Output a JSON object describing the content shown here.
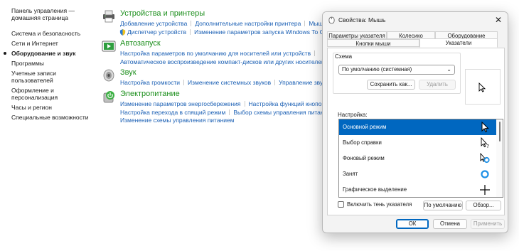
{
  "nav": {
    "home": "Панель управления —\nдомашняя страница",
    "items": [
      {
        "label": "Система и безопасность"
      },
      {
        "label": "Сети и Интернет"
      },
      {
        "label": "Оборудование и звук"
      },
      {
        "label": "Программы"
      },
      {
        "label": "Учетные записи\nпользователей"
      },
      {
        "label": "Оформление и\nперсонализация"
      },
      {
        "label": "Часы и регион"
      },
      {
        "label": "Специальные возможности"
      }
    ]
  },
  "categories": {
    "devices": {
      "title": "Устройства и принтеры",
      "row1": [
        "Добавление устройства",
        "Дополнительные настройки принтера",
        "Мышь"
      ],
      "row2": [
        "Диспетчер устройств",
        "Изменение параметров запуска Windows To Go"
      ]
    },
    "autoplay": {
      "title": "Автозапуск",
      "row1": [
        "Настройка параметров по умолчанию для носителей или устройств"
      ],
      "row2": [
        "Автоматическое воспроизведение компакт-дисков или других носителей"
      ]
    },
    "sound": {
      "title": "Звук",
      "row1": [
        "Настройка громкости",
        "Изменение системных звуков",
        "Управление звук"
      ]
    },
    "power": {
      "title": "Электропитание",
      "row1": [
        "Изменение параметров энергосбережения",
        "Настройка функций кнопок пит"
      ],
      "row2": [
        "Настройка перехода в спящий режим",
        "Выбор схемы управления питанием"
      ],
      "row3": [
        "Изменение схемы управления питанием"
      ]
    }
  },
  "dialog": {
    "title": "Свойства: Мышь",
    "close": "✕",
    "tabs": {
      "pointer_params": "Параметры указателя",
      "wheel": "Колесико",
      "hardware": "Оборудование",
      "buttons": "Кнопки мыши",
      "pointers": "Указатели"
    },
    "scheme_label": "Схема",
    "scheme_value": "По умолчанию (системная)",
    "save_as": "Сохранить как...",
    "delete": "Удалить",
    "customize_label": "Настройка:",
    "pointer_list": [
      {
        "label": "Основной режим",
        "icon": "arrow-cursor-icon",
        "selected": true
      },
      {
        "label": "Выбор справки",
        "icon": "help-cursor-icon",
        "selected": false
      },
      {
        "label": "Фоновый режим",
        "icon": "working-in-background-cursor-icon",
        "selected": false
      },
      {
        "label": "Занят",
        "icon": "busy-cursor-icon",
        "selected": false
      },
      {
        "label": "Графическое выделение",
        "icon": "crosshair-cursor-icon",
        "selected": false
      }
    ],
    "shadow_label": "Включить тень указателя",
    "shadow_checked": false,
    "default_btn": "По умолчанию",
    "browse_btn": "Обзор...",
    "ok": "ОК",
    "cancel": "Отмена",
    "apply": "Применить",
    "accent": "#0067c0"
  }
}
